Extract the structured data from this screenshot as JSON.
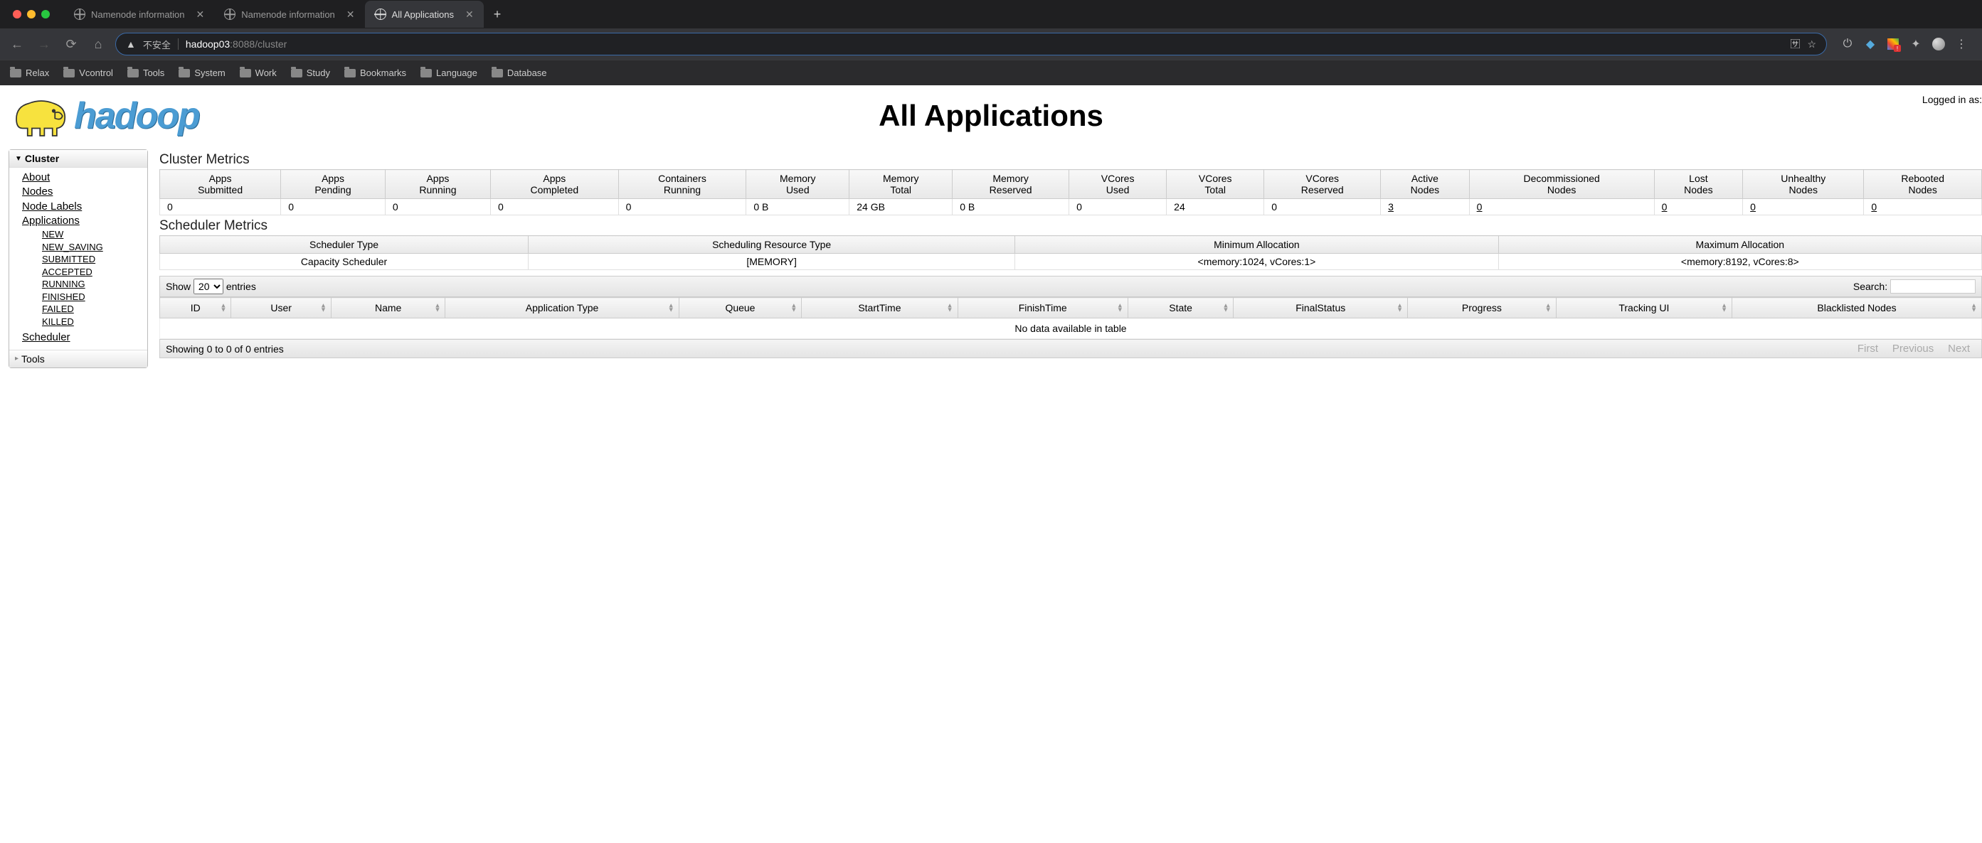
{
  "browser": {
    "tabs": [
      {
        "title": "Namenode information",
        "active": false
      },
      {
        "title": "Namenode information",
        "active": false
      },
      {
        "title": "All Applications",
        "active": true
      }
    ],
    "insecure_label": "不安全",
    "host": "hadoop03",
    "path": ":8088/cluster",
    "bookmarks": [
      "Relax",
      "Vcontrol",
      "Tools",
      "System",
      "Work",
      "Study",
      "Bookmarks",
      "Language",
      "Database"
    ]
  },
  "page": {
    "title": "All Applications",
    "logged_in": "Logged in as:"
  },
  "sidebar": {
    "cluster_label": "Cluster",
    "links": {
      "about": "About",
      "nodes": "Nodes",
      "node_labels": "Node Labels",
      "applications": "Applications",
      "scheduler": "Scheduler"
    },
    "app_states": [
      "NEW",
      "NEW_SAVING",
      "SUBMITTED",
      "ACCEPTED",
      "RUNNING",
      "FINISHED",
      "FAILED",
      "KILLED"
    ],
    "tools_label": "Tools"
  },
  "cluster_metrics": {
    "title": "Cluster Metrics",
    "headers": [
      "Apps Submitted",
      "Apps Pending",
      "Apps Running",
      "Apps Completed",
      "Containers Running",
      "Memory Used",
      "Memory Total",
      "Memory Reserved",
      "VCores Used",
      "VCores Total",
      "VCores Reserved",
      "Active Nodes",
      "Decommissioned Nodes",
      "Lost Nodes",
      "Unhealthy Nodes",
      "Rebooted Nodes"
    ],
    "row": [
      "0",
      "0",
      "0",
      "0",
      "0",
      "0 B",
      "24 GB",
      "0 B",
      "0",
      "24",
      "0",
      "3",
      "0",
      "0",
      "0",
      "0"
    ],
    "linked_cols": [
      11,
      12,
      13,
      14,
      15
    ]
  },
  "scheduler_metrics": {
    "title": "Scheduler Metrics",
    "headers": [
      "Scheduler Type",
      "Scheduling Resource Type",
      "Minimum Allocation",
      "Maximum Allocation"
    ],
    "row": [
      "Capacity Scheduler",
      "[MEMORY]",
      "<memory:1024, vCores:1>",
      "<memory:8192, vCores:8>"
    ]
  },
  "datatable": {
    "show_label": "Show",
    "entries_label": "entries",
    "page_size": "20",
    "search_label": "Search:",
    "headers": [
      "ID",
      "User",
      "Name",
      "Application Type",
      "Queue",
      "StartTime",
      "FinishTime",
      "State",
      "FinalStatus",
      "Progress",
      "Tracking UI",
      "Blacklisted Nodes"
    ],
    "no_data": "No data available in table",
    "info": "Showing 0 to 0 of 0 entries",
    "pager": {
      "first": "First",
      "prev": "Previous",
      "next": "Next"
    }
  }
}
